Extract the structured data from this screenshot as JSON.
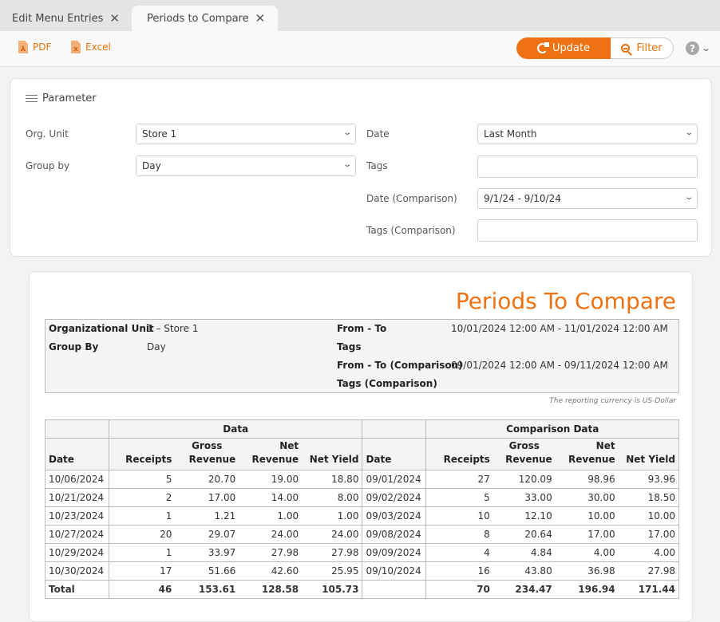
{
  "tabs": [
    {
      "label": "Edit Menu Entries",
      "active": false
    },
    {
      "label": "Periods to Compare",
      "active": true
    }
  ],
  "toolbar": {
    "pdf_label": "PDF",
    "excel_label": "Excel",
    "update_label": "Update",
    "filter_label": "Filter",
    "help_glyph": "?"
  },
  "parameters": {
    "title": "Parameter",
    "org_unit": {
      "label": "Org. Unit",
      "value": "Store 1"
    },
    "group_by": {
      "label": "Group by",
      "value": "Day"
    },
    "date": {
      "label": "Date",
      "value": "Last Month"
    },
    "tags": {
      "label": "Tags",
      "value": ""
    },
    "date_comparison": {
      "label": "Date (Comparison)",
      "value": "9/1/24 - 9/10/24"
    },
    "tags_comparison": {
      "label": "Tags (Comparison)",
      "value": ""
    }
  },
  "report": {
    "title": "Periods To Compare",
    "info": {
      "org_unit_label": "Organizational Unit",
      "org_unit_value": "1 – Store 1",
      "group_by_label": "Group By",
      "group_by_value": "Day",
      "from_to_label": "From - To",
      "from_to_value": "10/01/2024 12:00 AM - 11/01/2024 12:00 AM",
      "tags_label": "Tags",
      "tags_value": "",
      "from_to_cmp_label": "From - To (Comparison)",
      "from_to_cmp_value": "09/01/2024 12:00 AM - 09/11/2024 12:00 AM",
      "tags_cmp_label": "Tags (Comparison)",
      "tags_cmp_value": ""
    },
    "currency_note": "The reporting currency is US-Dollar",
    "table": {
      "group_data": "Data",
      "group_comparison": "Comparison Data",
      "columns": {
        "date": "Date",
        "receipts": "Receipts",
        "gross_line1": "Gross",
        "gross_line2": "Revenue",
        "net_revenue": "Net Revenue",
        "net_yield": "Net Yield"
      },
      "rows": [
        {
          "date": "10/06/2024",
          "receipts": "5",
          "gross": "20.70",
          "net": "19.00",
          "yield": "18.80",
          "c_date": "09/01/2024",
          "c_receipts": "27",
          "c_gross": "120.09",
          "c_net": "98.96",
          "c_yield": "93.96"
        },
        {
          "date": "10/21/2024",
          "receipts": "2",
          "gross": "17.00",
          "net": "14.00",
          "yield": "8.00",
          "c_date": "09/02/2024",
          "c_receipts": "5",
          "c_gross": "33.00",
          "c_net": "30.00",
          "c_yield": "18.50"
        },
        {
          "date": "10/23/2024",
          "receipts": "1",
          "gross": "1.21",
          "net": "1.00",
          "yield": "1.00",
          "c_date": "09/03/2024",
          "c_receipts": "10",
          "c_gross": "12.10",
          "c_net": "10.00",
          "c_yield": "10.00"
        },
        {
          "date": "10/27/2024",
          "receipts": "20",
          "gross": "29.07",
          "net": "24.00",
          "yield": "24.00",
          "c_date": "09/08/2024",
          "c_receipts": "8",
          "c_gross": "20.64",
          "c_net": "17.00",
          "c_yield": "17.00"
        },
        {
          "date": "10/29/2024",
          "receipts": "1",
          "gross": "33.97",
          "net": "27.98",
          "yield": "27.98",
          "c_date": "09/09/2024",
          "c_receipts": "4",
          "c_gross": "4.84",
          "c_net": "4.00",
          "c_yield": "4.00"
        },
        {
          "date": "10/30/2024",
          "receipts": "17",
          "gross": "51.66",
          "net": "42.60",
          "yield": "25.95",
          "c_date": "09/10/2024",
          "c_receipts": "16",
          "c_gross": "43.80",
          "c_net": "36.98",
          "c_yield": "27.98"
        }
      ],
      "total": {
        "label": "Total",
        "receipts": "46",
        "gross": "153.61",
        "net": "128.58",
        "yield": "105.73",
        "c_date": "",
        "c_receipts": "70",
        "c_gross": "234.47",
        "c_net": "196.94",
        "c_yield": "171.44"
      }
    }
  }
}
